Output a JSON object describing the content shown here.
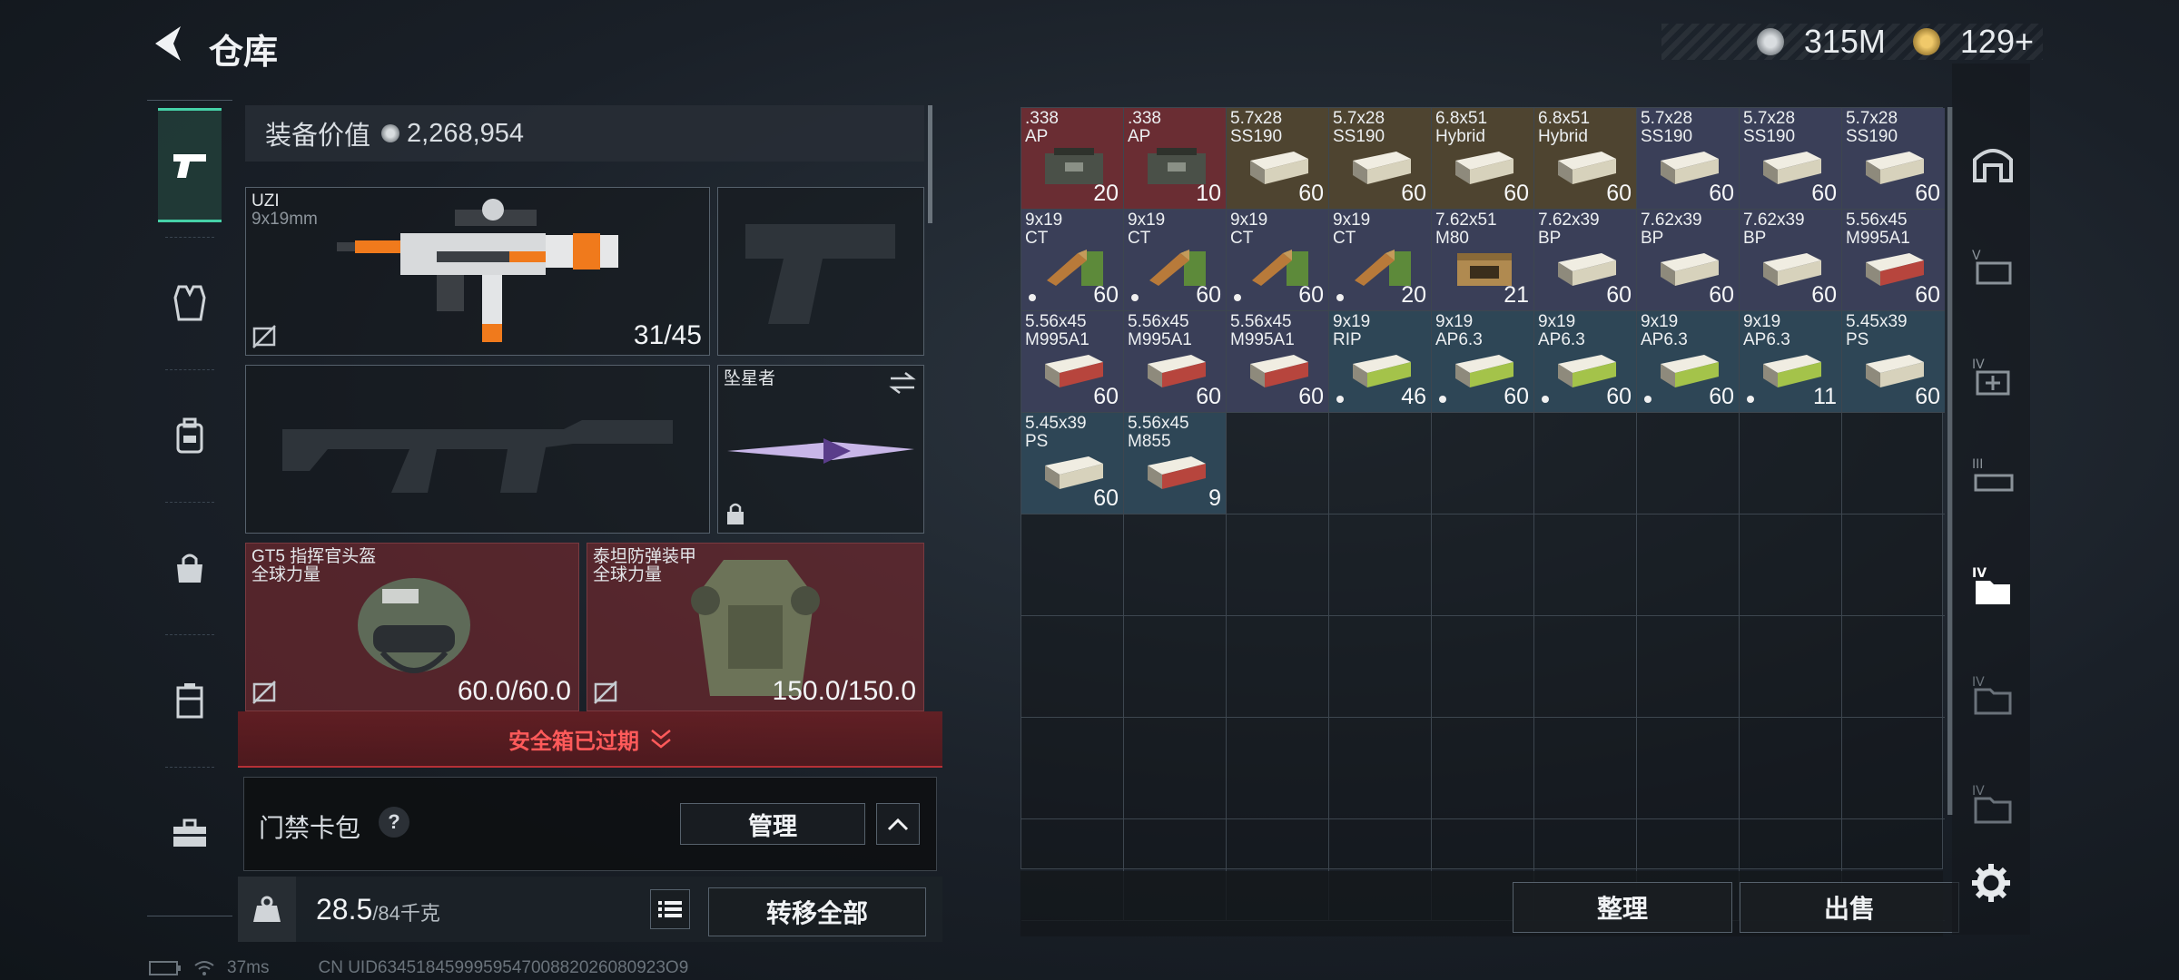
{
  "header": {
    "title": "仓库",
    "currency_silver": "315M",
    "currency_gold": "129+"
  },
  "tabs": [
    {
      "name": "tab-weapons",
      "icon": "pistol-icon",
      "active": true
    },
    {
      "name": "tab-vest",
      "icon": "vest-icon"
    },
    {
      "name": "tab-backpack",
      "icon": "backpack-icon"
    },
    {
      "name": "tab-bag",
      "icon": "bag-icon"
    },
    {
      "name": "tab-container",
      "icon": "case-icon"
    },
    {
      "name": "tab-toolbox",
      "icon": "toolbox-icon"
    }
  ],
  "loadout": {
    "value_label": "装备价值",
    "value": "2,268,954",
    "primary": {
      "name": "UZI",
      "caliber": "9x19mm",
      "ammo": "31/45"
    },
    "melee": {
      "name": "坠星者"
    },
    "helmet": {
      "name": "GT5 指挥官头盔",
      "faction": "全球力量",
      "durability": "60.0/60.0"
    },
    "armor": {
      "name": "泰坦防弹装甲",
      "faction": "全球力量",
      "durability": "150.0/150.0"
    },
    "safe_box_expired": "安全箱已过期",
    "card_pack_label": "门禁卡包",
    "card_pack_help": "?",
    "manage_label": "管理",
    "weight_current": "28.5",
    "weight_max": "/84千克",
    "transfer_all": "转移全部"
  },
  "stash": {
    "items": [
      {
        "l1": ".338",
        "l2": "AP",
        "qty": "20",
        "bg": "#6a2d33",
        "kind": "can",
        "dot": false
      },
      {
        "l1": ".338",
        "l2": "AP",
        "qty": "10",
        "bg": "#6a2d33",
        "kind": "can",
        "dot": false
      },
      {
        "l1": "5.7x28",
        "l2": "SS190",
        "qty": "60",
        "bg": "#4e4430",
        "kind": "box",
        "dot": false
      },
      {
        "l1": "5.7x28",
        "l2": "SS190",
        "qty": "60",
        "bg": "#4e4430",
        "kind": "box",
        "dot": false
      },
      {
        "l1": "6.8x51",
        "l2": "Hybrid",
        "qty": "60",
        "bg": "#4e4430",
        "kind": "box",
        "dot": false
      },
      {
        "l1": "6.8x51",
        "l2": "Hybrid",
        "qty": "60",
        "bg": "#4e4430",
        "kind": "box",
        "dot": false
      },
      {
        "l1": "5.7x28",
        "l2": "SS190",
        "qty": "60",
        "bg": "#3a3f58",
        "kind": "box",
        "dot": false
      },
      {
        "l1": "5.7x28",
        "l2": "SS190",
        "qty": "60",
        "bg": "#3a3f58",
        "kind": "box",
        "dot": false
      },
      {
        "l1": "5.7x28",
        "l2": "SS190",
        "qty": "60",
        "bg": "#3a3f58",
        "kind": "box",
        "dot": false
      },
      {
        "l1": "9x19",
        "l2": "CT",
        "qty": "60",
        "bg": "#3a3f58",
        "kind": "bullet",
        "dot": true
      },
      {
        "l1": "9x19",
        "l2": "CT",
        "qty": "60",
        "bg": "#3a3f58",
        "kind": "bullet",
        "dot": true
      },
      {
        "l1": "9x19",
        "l2": "CT",
        "qty": "60",
        "bg": "#3a3f58",
        "kind": "bullet",
        "dot": true
      },
      {
        "l1": "9x19",
        "l2": "CT",
        "qty": "20",
        "bg": "#3a3f58",
        "kind": "bullet",
        "dot": true
      },
      {
        "l1": "7.62x51",
        "l2": "M80",
        "qty": "21",
        "bg": "#3a3f58",
        "kind": "crate",
        "dot": false
      },
      {
        "l1": "7.62x39",
        "l2": "BP",
        "qty": "60",
        "bg": "#3a3f58",
        "kind": "box",
        "dot": false
      },
      {
        "l1": "7.62x39",
        "l2": "BP",
        "qty": "60",
        "bg": "#3a3f58",
        "kind": "box",
        "dot": false
      },
      {
        "l1": "7.62x39",
        "l2": "BP",
        "qty": "60",
        "bg": "#3a3f58",
        "kind": "box",
        "dot": false
      },
      {
        "l1": "5.56x45",
        "l2": "M995A1",
        "qty": "60",
        "bg": "#3a3f58",
        "kind": "redbox",
        "dot": false
      },
      {
        "l1": "5.56x45",
        "l2": "M995A1",
        "qty": "60",
        "bg": "#3a3f58",
        "kind": "redbox",
        "dot": false
      },
      {
        "l1": "5.56x45",
        "l2": "M995A1",
        "qty": "60",
        "bg": "#3a3f58",
        "kind": "redbox",
        "dot": false
      },
      {
        "l1": "5.56x45",
        "l2": "M995A1",
        "qty": "60",
        "bg": "#3a3f58",
        "kind": "redbox",
        "dot": false
      },
      {
        "l1": "9x19",
        "l2": "RIP",
        "qty": "46",
        "bg": "#2e4656",
        "kind": "greenbox",
        "dot": true
      },
      {
        "l1": "9x19",
        "l2": "AP6.3",
        "qty": "60",
        "bg": "#2e4656",
        "kind": "greenbox",
        "dot": true
      },
      {
        "l1": "9x19",
        "l2": "AP6.3",
        "qty": "60",
        "bg": "#2e4656",
        "kind": "greenbox",
        "dot": true
      },
      {
        "l1": "9x19",
        "l2": "AP6.3",
        "qty": "60",
        "bg": "#2e4656",
        "kind": "greenbox",
        "dot": true
      },
      {
        "l1": "9x19",
        "l2": "AP6.3",
        "qty": "11",
        "bg": "#2e4656",
        "kind": "greenbox",
        "dot": true
      },
      {
        "l1": "5.45x39",
        "l2": "PS",
        "qty": "60",
        "bg": "#2e4656",
        "kind": "box",
        "dot": false
      },
      {
        "l1": "5.45x39",
        "l2": "PS",
        "qty": "60",
        "bg": "#2e4656",
        "kind": "box",
        "dot": false
      },
      {
        "l1": "5.56x45",
        "l2": "M855",
        "qty": "9",
        "bg": "#2e4656",
        "kind": "redbox",
        "dot": false
      }
    ],
    "sort_label": "整理",
    "sell_label": "出售"
  },
  "status": {
    "ping": "37ms",
    "uid": "CN UID634518459995954700882026080923O9"
  },
  "colors": {
    "accent": "#46d1a8",
    "danger": "#ff5a5a",
    "expired_bg": "#7a2226"
  }
}
